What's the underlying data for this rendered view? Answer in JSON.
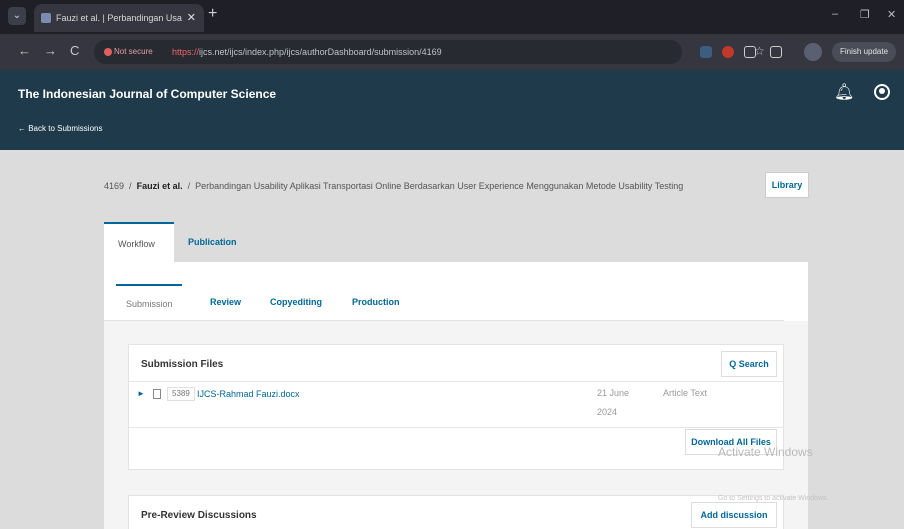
{
  "browser": {
    "tab_title": "Fauzi et al. | Perbandingan Usa",
    "close_glyph": "✕",
    "new_tab_glyph": "+",
    "menu_glyph": "⌄",
    "not_secure": "Not secure",
    "url_scheme": "https://",
    "url_rest": "ijcs.net/ijcs/index.php/ijcs/authorDashboard/submission/4169",
    "finish_update": "Finish update",
    "back": "←",
    "forward": "→",
    "reload": "C",
    "star": "☆",
    "minimize": "–",
    "maximize": "❐",
    "close": "✕"
  },
  "header": {
    "journal_title": "The Indonesian Journal of Computer Science",
    "back_link": "← Back to Submissions",
    "bell": "🔔"
  },
  "breadcrumb": {
    "id": "4169",
    "sep": "/",
    "authors": "Fauzi et al.",
    "title": "Perbandingan Usability Aplikasi Transportasi Online Berdasarkan User Experience Menggunakan Metode Usability Testing",
    "library": "Library"
  },
  "top_tabs": [
    "Workflow",
    "Publication"
  ],
  "stage_tabs": [
    "Submission",
    "Review",
    "Copyediting",
    "Production"
  ],
  "submission_files": {
    "title": "Submission Files",
    "search": "Q Search",
    "row": {
      "id": "5389",
      "name": "IJCS-Rahmad Fauzi.docx",
      "date_day": "21 June",
      "date_year": "2024",
      "type": "Article Text"
    },
    "download_all": "Download All Files"
  },
  "discussions": {
    "title": "Pre-Review Discussions",
    "add": "Add discussion"
  },
  "watermark": {
    "main": "Activate Windows",
    "sub": "Go to Settings to activate Windows."
  }
}
